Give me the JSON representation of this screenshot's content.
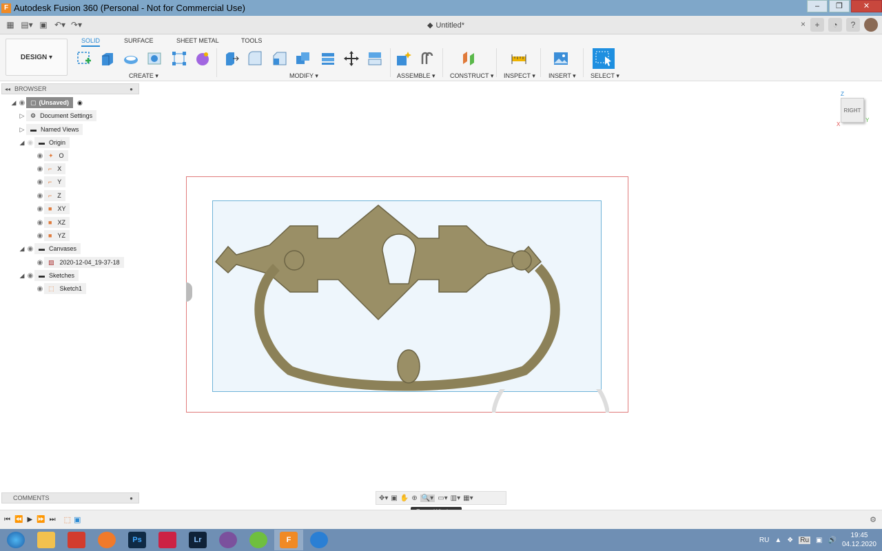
{
  "titlebar": {
    "title": "Autodesk Fusion 360 (Personal - Not for Commercial Use)",
    "minimize": "–",
    "maximize": "❐",
    "close": "✕"
  },
  "qat": {
    "doc_title": "Untitled*",
    "close": "×",
    "add": "+"
  },
  "ribbon": {
    "workspace": "DESIGN ▾",
    "tabs": [
      "SOLID",
      "SURFACE",
      "SHEET METAL",
      "TOOLS"
    ],
    "groups": [
      "CREATE ▾",
      "MODIFY ▾",
      "ASSEMBLE ▾",
      "CONSTRUCT ▾",
      "INSPECT ▾",
      "INSERT ▾",
      "SELECT ▾"
    ]
  },
  "browser": {
    "title": "BROWSER",
    "items": [
      {
        "label": "(Unsaved)"
      },
      {
        "label": "Document Settings"
      },
      {
        "label": "Named Views"
      },
      {
        "label": "Origin"
      },
      {
        "label": "O"
      },
      {
        "label": "X"
      },
      {
        "label": "Y"
      },
      {
        "label": "Z"
      },
      {
        "label": "XY"
      },
      {
        "label": "XZ"
      },
      {
        "label": "YZ"
      },
      {
        "label": "Canvases"
      },
      {
        "label": "2020-12-04_19-37-18"
      },
      {
        "label": "Sketches"
      },
      {
        "label": "Sketch1"
      }
    ]
  },
  "viewcube": {
    "face": "RIGHT",
    "axis_z": "Z",
    "axis_y": "Y",
    "axis_x": "X"
  },
  "comments": {
    "label": "COMMENTS"
  },
  "tooltip": {
    "label": "Zoom Window"
  },
  "tray": {
    "lang": "RU",
    "lang2": "Ru",
    "time": "19:45",
    "date": "04.12.2020"
  },
  "colors": {
    "titlebar": "#7fa7c9",
    "accent": "#2a8ad4",
    "canvas_border": "#e07a7a",
    "sketch_border": "#6fb3d8",
    "taskbar": "#6f8fb4"
  }
}
